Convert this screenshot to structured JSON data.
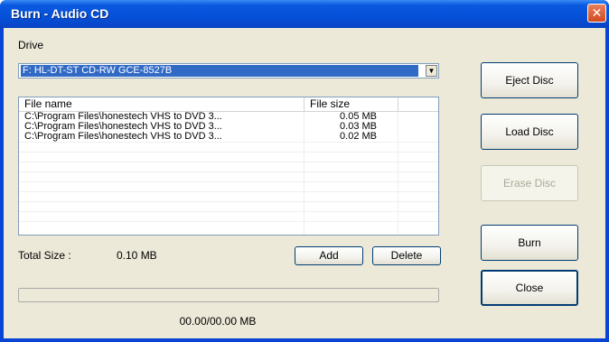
{
  "window": {
    "title": "Burn - Audio CD",
    "close_glyph": "✕"
  },
  "drive": {
    "label": "Drive",
    "selected": "F: HL-DT-ST CD-RW GCE-8527B",
    "arrow_glyph": "▼"
  },
  "file_list": {
    "columns": [
      "File name",
      "File size"
    ],
    "rows": [
      {
        "name": "C:\\Program Files\\honestech VHS to DVD 3...",
        "size": "0.05 MB"
      },
      {
        "name": "C:\\Program Files\\honestech VHS to DVD 3...",
        "size": "0.03 MB"
      },
      {
        "name": "C:\\Program Files\\honestech VHS to DVD 3...",
        "size": "0.02 MB"
      }
    ]
  },
  "total": {
    "label": "Total Size :",
    "value": "0.10 MB"
  },
  "buttons": {
    "add": "Add",
    "delete": "Delete",
    "eject": "Eject Disc",
    "load": "Load Disc",
    "erase": "Erase Disc",
    "burn": "Burn",
    "close": "Close"
  },
  "progress": {
    "text": "00.00/00.00 MB",
    "fraction": 0
  },
  "colors": {
    "title_bar": "#0550d8",
    "selection": "#316ac5",
    "dialog_bg": "#ece9d8",
    "close_button": "#d04a20"
  }
}
